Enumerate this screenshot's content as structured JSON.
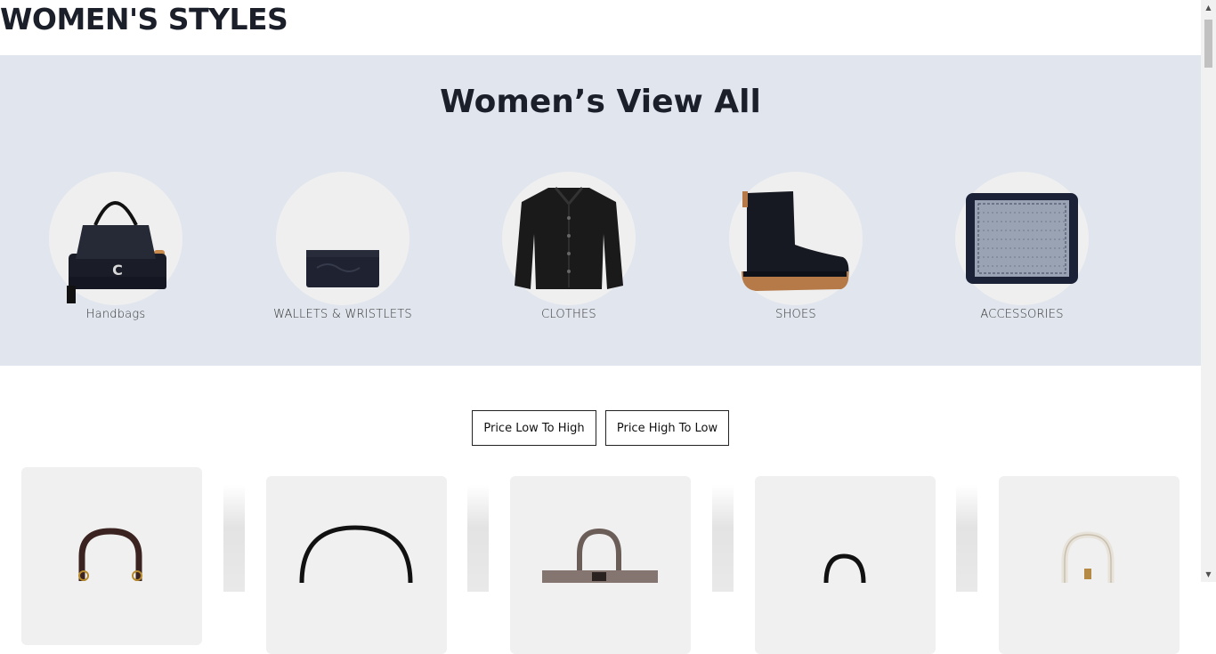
{
  "page": {
    "title": "WOMEN'S STYLES"
  },
  "banner": {
    "title": "Women’s View All",
    "categories": [
      {
        "label": "Handbags",
        "icon": "handbag-icon"
      },
      {
        "label": "WALLETS & WRISTLETS",
        "icon": "wristlet-icon"
      },
      {
        "label": "CLOTHES",
        "icon": "jacket-icon"
      },
      {
        "label": "SHOES",
        "icon": "boot-icon"
      },
      {
        "label": "ACCESSORIES",
        "icon": "scarf-icon"
      }
    ]
  },
  "sort": {
    "low_to_high": "Price Low To High",
    "high_to_low": "Price High To Low"
  },
  "products": [
    {
      "image": "brown-handle-bag-image"
    },
    {
      "image": "black-shoulder-bag-image"
    },
    {
      "image": "taupe-tote-bag-image"
    },
    {
      "image": "black-mini-bag-image"
    },
    {
      "image": "white-satchel-bag-image"
    }
  ],
  "colors": {
    "banner_bg": "#e1e6ee",
    "circle_bg": "#efefef",
    "card_bg": "#f0f0f0",
    "text": "#1b1f2a"
  }
}
